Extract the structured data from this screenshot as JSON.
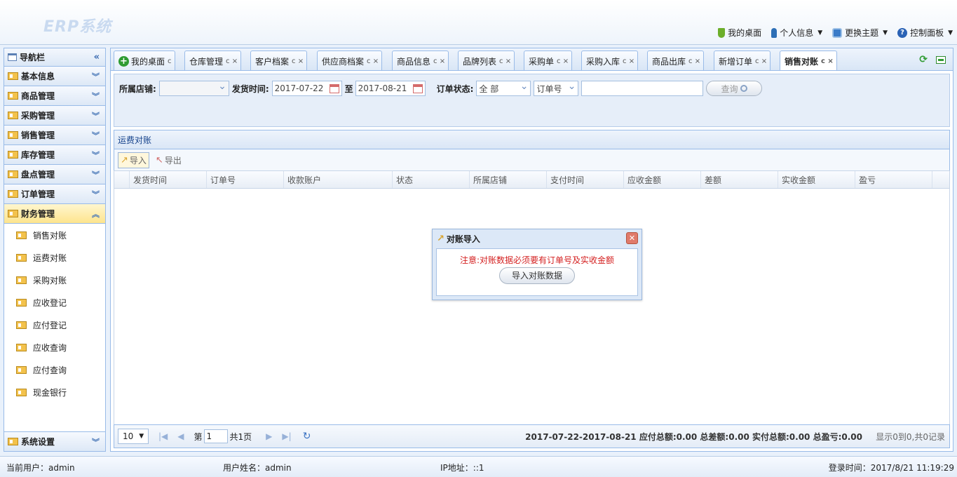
{
  "app": {
    "logo": "ERP系统"
  },
  "header_links": [
    {
      "label": "我的桌面",
      "icon": "desktop-icon",
      "color": "#6cae2a"
    },
    {
      "label": "个人信息",
      "icon": "user-icon",
      "color": "#2d6fb6"
    },
    {
      "label": "更换主题",
      "icon": "theme-icon",
      "color": "#3a7bc8"
    },
    {
      "label": "控制面板",
      "icon": "help-icon",
      "color": "#2a62b5"
    }
  ],
  "sidebar": {
    "title": "导航栏",
    "collapse_glyph": "«",
    "groups": [
      {
        "label": "基本信息"
      },
      {
        "label": "商品管理"
      },
      {
        "label": "采购管理"
      },
      {
        "label": "销售管理"
      },
      {
        "label": "库存管理"
      },
      {
        "label": "盘点管理"
      },
      {
        "label": "订单管理"
      },
      {
        "label": "财务管理"
      }
    ],
    "finance_items": [
      {
        "label": "销售对账"
      },
      {
        "label": "运费对账"
      },
      {
        "label": "采购对账"
      },
      {
        "label": "应收登记"
      },
      {
        "label": "应付登记"
      },
      {
        "label": "应收查询"
      },
      {
        "label": "应付查询"
      },
      {
        "label": "现金银行"
      }
    ],
    "bottom_group": {
      "label": "系统设置"
    }
  },
  "tabs": [
    {
      "label": "我的桌面",
      "ctl": "c"
    },
    {
      "label": "仓库管理",
      "ctl": "c ×"
    },
    {
      "label": "客户档案",
      "ctl": "c ×"
    },
    {
      "label": "供应商档案",
      "ctl": "c ×"
    },
    {
      "label": "商品信息",
      "ctl": "c ×"
    },
    {
      "label": "品牌列表",
      "ctl": "c ×"
    },
    {
      "label": "采购单",
      "ctl": "c ×"
    },
    {
      "label": "采购入库",
      "ctl": "c ×"
    },
    {
      "label": "商品出库",
      "ctl": "c ×"
    },
    {
      "label": "新增订单",
      "ctl": "c ×"
    },
    {
      "label": "销售对账",
      "ctl": "c ×"
    }
  ],
  "filter": {
    "store_label": "所属店铺:",
    "store_value": "",
    "ship_time_label": "发货时间:",
    "date_from": "2017-07-22",
    "to_label": "至",
    "date_to": "2017-08-21",
    "status_label": "订单状态:",
    "status_value": "全 部",
    "field_value": "订单号",
    "keyword": "",
    "query_label": "查询"
  },
  "panel": {
    "title": "运费对账",
    "import_label": "导入",
    "export_label": "导出"
  },
  "grid": {
    "columns": [
      "发货时间",
      "订单号",
      "收款账户",
      "状态",
      "所属店铺",
      "支付时间",
      "应收金额",
      "差额",
      "实收金额",
      "盈亏"
    ]
  },
  "pager": {
    "page_size": "10",
    "page_prefix": "第",
    "page_num": "1",
    "page_suffix": "共1页",
    "summary": "2017-07-22-2017-08-21 应付总额:0.00 总差额:0.00 实付总额:0.00 总盈亏:0.00",
    "records": "显示0到0,共0记录"
  },
  "modal": {
    "title": "对账导入",
    "note": "注意:对账数据必须要有订单号及实收金额",
    "button": "导入对账数据"
  },
  "status": {
    "current_user": "当前用户：admin",
    "user_name": "用户姓名：admin",
    "ip": "IP地址：::1",
    "login_time": "登录时间：2017/8/21 11:19:29"
  }
}
